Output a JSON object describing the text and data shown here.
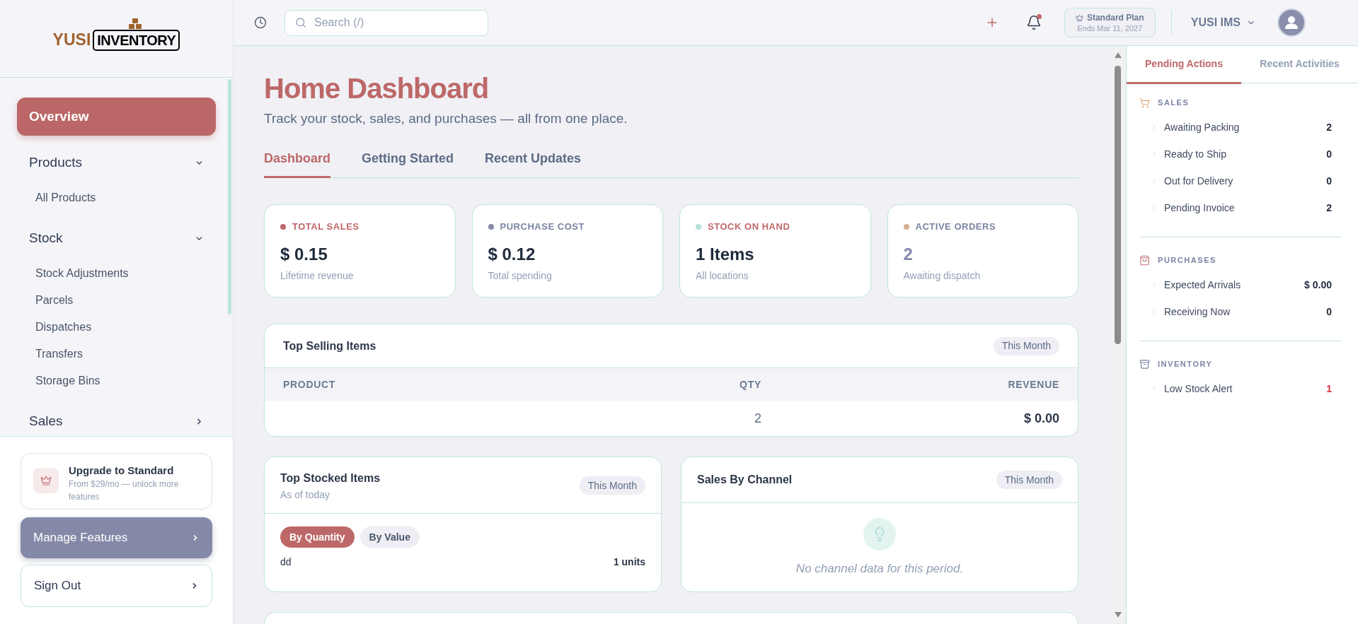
{
  "sidebar": {
    "logo": {
      "brand": "YUSI",
      "product": "INVENTORY"
    },
    "nav": [
      {
        "kind": "link",
        "label": "Overview",
        "selected": true
      },
      {
        "kind": "group",
        "label": "Products",
        "expanded": true,
        "children": [
          {
            "label": "All Products",
            "selected": false
          }
        ]
      },
      {
        "kind": "group",
        "label": "Stock",
        "expanded": true,
        "children": [
          {
            "label": "Stock Adjustments",
            "selected": false
          },
          {
            "label": "Parcels",
            "selected": false
          },
          {
            "label": "Dispatches",
            "selected": false
          },
          {
            "label": "Transfers",
            "selected": false
          },
          {
            "label": "Storage Bins",
            "selected": false
          }
        ]
      },
      {
        "kind": "group",
        "label": "Sales",
        "expanded": false
      }
    ],
    "upgrade": {
      "title": "Upgrade to Standard",
      "text": "From $29/mo — unlock more features"
    },
    "actions": [
      {
        "kind": "filled",
        "label": "Manage Features"
      },
      {
        "kind": "outline",
        "label": "Sign Out"
      }
    ]
  },
  "topbar": {
    "search": {
      "placeholder": "Search (/)"
    },
    "notifications": {
      "unread": true
    },
    "plan": {
      "name": "Standard Plan",
      "ends": "Ends Mar 11, 2027"
    },
    "account": {
      "name": "YUSI IMS"
    }
  },
  "page": {
    "title": "Home Dashboard",
    "subtitle": "Track your stock, sales, and purchases — all from one place.",
    "tabs": [
      {
        "label": "Dashboard",
        "selected": true
      },
      {
        "label": "Getting Started",
        "selected": false
      },
      {
        "label": "Recent Updates",
        "selected": false
      }
    ]
  },
  "stats": [
    {
      "label": "TOTAL SALES",
      "value": "$ 0.15",
      "caption": "Lifetime revenue",
      "color": "#c0676a",
      "accent_label": true,
      "muted": false
    },
    {
      "label": "PURCHASE COST",
      "value": "$ 0.12",
      "caption": "Total spending",
      "color": "#8589a8",
      "accent_label": false,
      "muted": false
    },
    {
      "label": "STOCK ON HAND",
      "value": "1 Items",
      "caption": "All locations",
      "color": "#b5e0d9",
      "accent_label": true,
      "muted": false
    },
    {
      "label": "ACTIVE ORDERS",
      "value": "2",
      "caption": "Awaiting dispatch",
      "color": "#d4b090",
      "accent_label": false,
      "muted": true
    }
  ],
  "top_selling": {
    "title": "Top Selling Items",
    "period": "This Month",
    "columns": [
      "PRODUCT",
      "QTY",
      "REVENUE"
    ],
    "rows": [
      {
        "qty": "2",
        "revenue": "$ 0.00"
      }
    ]
  },
  "top_stocked": {
    "title": "Top Stocked Items",
    "subtitle": "As of today",
    "period": "This Month",
    "toggles": [
      {
        "label": "By Quantity",
        "selected": true
      },
      {
        "label": "By Value",
        "selected": false
      }
    ],
    "rows": [
      {
        "name": "dd",
        "amount": "1 units"
      }
    ]
  },
  "sales_by_channel": {
    "title": "Sales By Channel",
    "period": "This Month",
    "empty_text": "No channel data for this period."
  },
  "right_panel": {
    "tabs": [
      {
        "label": "Pending Actions",
        "selected": true
      },
      {
        "label": "Recent Activities",
        "selected": false
      }
    ],
    "sections": [
      {
        "kind": "sales",
        "title": "SALES",
        "items": [
          {
            "label": "Awaiting Packing",
            "value": "2",
            "alert": false
          },
          {
            "label": "Ready to Ship",
            "value": "0",
            "alert": false
          },
          {
            "label": "Out for Delivery",
            "value": "0",
            "alert": false
          },
          {
            "label": "Pending Invoice",
            "value": "2",
            "alert": false
          }
        ]
      },
      {
        "kind": "purchases",
        "title": "PURCHASES",
        "items": [
          {
            "label": "Expected Arrivals",
            "value": "$ 0.00",
            "alert": false
          },
          {
            "label": "Receiving Now",
            "value": "0",
            "alert": false
          }
        ]
      },
      {
        "kind": "inventory",
        "title": "INVENTORY",
        "items": [
          {
            "label": "Low Stock Alert",
            "value": "1",
            "alert": true
          }
        ]
      }
    ]
  }
}
